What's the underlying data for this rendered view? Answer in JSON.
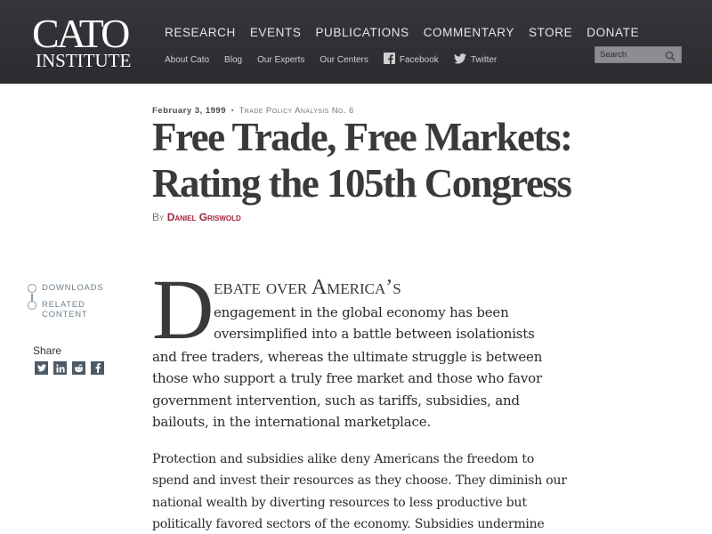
{
  "logo": {
    "top": "CATO",
    "bottom": "INSTITUTE"
  },
  "main_nav": [
    "RESEARCH",
    "EVENTS",
    "PUBLICATIONS",
    "COMMENTARY",
    "STORE",
    "DONATE"
  ],
  "sub_nav": {
    "about": "About Cato",
    "blog": "Blog",
    "experts": "Our Experts",
    "centers": "Our Centers",
    "facebook": "Facebook",
    "twitter": "Twitter"
  },
  "search": {
    "placeholder": "Search",
    "icon": "magnifier-icon"
  },
  "article": {
    "date": "February 3, 1999",
    "separator": "•",
    "series": "Trade Policy Analysis No. 6",
    "title_line1": "Free Trade, Free Markets:",
    "title_line2": "Rating the 105th Congress",
    "by": "By",
    "author": "Daniel Griswold"
  },
  "sidebar": {
    "downloads": "Downloads",
    "related_line1": "Related",
    "related_line2": "Content",
    "share_label": "Share",
    "share_icons": [
      "twitter-icon",
      "linkedin-icon",
      "reddit-icon",
      "facebook-icon"
    ]
  },
  "body": {
    "dropcap": "D",
    "lead_first": "ebate over America’s",
    "lead_lines": [
      "engagement in the global economy has been",
      "oversimplified into a battle between isolationists",
      "and free traders, whereas the ultimate struggle is between",
      "those who support a truly free market and those who favor",
      "government intervention, such as tariffs, subsidies, and",
      "bailouts, in the international marketplace."
    ],
    "para2_lines": [
      "Protection and subsidies alike deny Americans the freedom to",
      "spend and invest their resources as they choose. They diminish our",
      "national wealth by diverting resources to less productive but",
      "politically favored sectors of the economy. Subsidies undermine"
    ]
  },
  "colors": {
    "header_bg": "#2f3136",
    "author_red": "#a3233a",
    "sidebar_blue_gray": "#6b7f8c"
  }
}
